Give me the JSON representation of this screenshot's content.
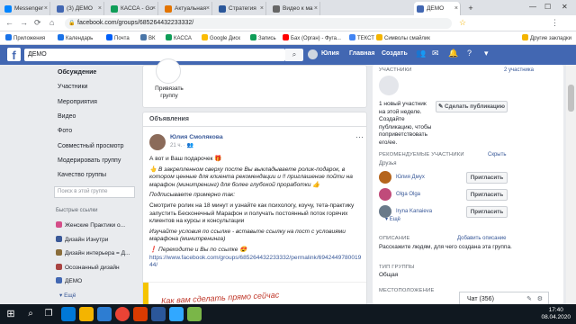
{
  "browser": {
    "tabs": [
      {
        "label": "Messenger",
        "color": "#0084ff"
      },
      {
        "label": "(3) ДЕМО",
        "color": "#4267b2"
      },
      {
        "label": "КАССА - Go",
        "color": "#0f9d58"
      },
      {
        "label": "Актуальная",
        "color": "#e37400"
      },
      {
        "label": "Стратегия",
        "color": "#2b579a"
      },
      {
        "label": "Видео к ма",
        "color": "#666666"
      },
      {
        "label": "ДЕМО",
        "color": "#4267b2",
        "active": true
      }
    ],
    "url": "facebook.com/groups/685264432233332/",
    "bookmarks": [
      {
        "label": "Приложения",
        "color": "#1a73e8"
      },
      {
        "label": "Календарь",
        "color": "#1a73e8"
      },
      {
        "label": "Почта",
        "color": "#005ff9"
      },
      {
        "label": "ВК",
        "color": "#4a76a8"
      },
      {
        "label": "КАССА",
        "color": "#0f9d58"
      },
      {
        "label": "Google Диск",
        "color": "#fbbc04"
      },
      {
        "label": "Запись",
        "color": "#0f9d58"
      },
      {
        "label": "Бах (Орган) - Фуга...",
        "color": "#ff0000"
      },
      {
        "label": "ТЕКСТ",
        "color": "#4285f4"
      },
      {
        "label": "Символы смайлик",
        "color": "#f4b400"
      },
      {
        "label": "Другие закладки",
        "color": "#f4b400"
      }
    ]
  },
  "fb_header": {
    "search_value": "ДЕМО",
    "user_name": "Юлия",
    "home": "Главная",
    "create": "Создать"
  },
  "left_nav": {
    "items": [
      "Обсуждение",
      "Участники",
      "Мероприятия",
      "Видео",
      "Фото",
      "Совместный просмотр",
      "Модерировать группу",
      "Качество группы"
    ],
    "search_placeholder": "Поиск в этой группе",
    "quick_title": "Быстрые ссылки",
    "quick_links": [
      {
        "label": "Женские Практики о...",
        "color": "#d44d88"
      },
      {
        "label": "Дизайн Изнутри",
        "color": "#3b5998"
      },
      {
        "label": "Дизайн интерьера = Д...",
        "color": "#8a6d3b"
      },
      {
        "label": "Осознанный дизайн",
        "color": "#a94442"
      },
      {
        "label": "ДЕМО",
        "color": "#4267b2"
      }
    ],
    "more": "Ещё"
  },
  "center": {
    "pin_label": "Привязать группу",
    "section_title": "Объявления",
    "post": {
      "author": "Юлия Смолякова",
      "time": "21 ч.",
      "p1": "А вот и Ваш подарочек 🎁",
      "p2": "👆 В закрепленном сверху посте Вы выкладываете ролик-подарок, в котором ценные для клиента рекомендации и !! приглашение пойти на марафон (минитренинг) для более глубокой проработки 👍",
      "p3": "Подписываете примерно так:",
      "p4": "Смотрите ролик на 18 минут и узнайте как психологу, коучу, тета-практику запустить Бесконечный Марафон и получать постоянный поток горячих клиентов на курсы и консультации",
      "p5": "Изучайте условия по ссылке - вставьте ссылку на пост с условиями марафона (минитренинга)",
      "p6": "❗ Переходите и Вы по ссылке 😍",
      "link": "https://www.facebook.com/groups/685264432233332/permalink/694244978001944/",
      "video_text": "Как вам сделать прямо сейчас"
    }
  },
  "right": {
    "members_label": "УЧАСТНИКИ",
    "members_count": "2 участника",
    "new_member": "1 новый участник на этой неделе. Создайте публикацию, чтобы поприветствовать его/ее.",
    "create_post_btn": "Сделать публикацию",
    "suggested_label": "РЕКОМЕНДУЕМЫЕ УЧАСТНИКИ",
    "hide": "Скрыть",
    "friends": "Друзья",
    "people": [
      {
        "name": "Юлия Дмух",
        "color": "#b5651d"
      },
      {
        "name": "Olga Olga",
        "color": "#c04b7a"
      },
      {
        "name": "Iryna Kanaieva",
        "color": "#6a7a8a"
      }
    ],
    "invite": "Пригласить",
    "more": "Ещё",
    "desc_label": "ОПИСАНИЕ",
    "add_desc": "Добавить описание",
    "desc_text": "Расскажите людям, для чего создана эта группа.",
    "type_label": "ТИП ГРУППЫ",
    "type_value": "Общая",
    "location_label": "МЕСТОПОЛОЖЕНИЕ"
  },
  "chat": {
    "label": "Чат (356)"
  },
  "taskbar": {
    "time": "17:40",
    "date": "08.04.2020"
  }
}
